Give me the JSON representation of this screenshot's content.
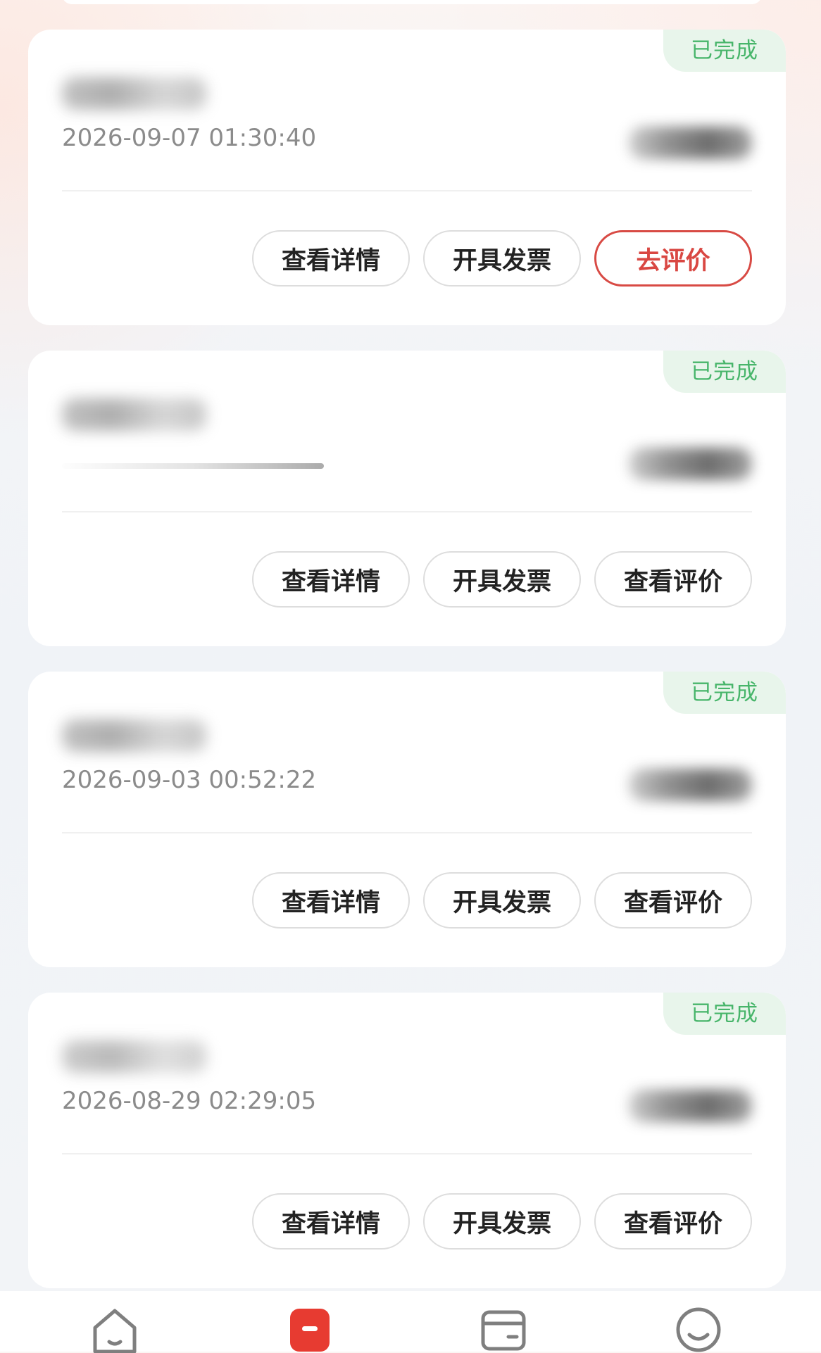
{
  "orders": [
    {
      "status": "已完成",
      "time": "2026-09-07 01:30:40",
      "actions": {
        "details": "查看详情",
        "invoice": "开具发票",
        "review": "去评价"
      }
    },
    {
      "status": "已完成",
      "time": "",
      "actions": {
        "details": "查看详情",
        "invoice": "开具发票",
        "review": "查看评价"
      }
    },
    {
      "status": "已完成",
      "time": "2026-09-03 00:52:22",
      "actions": {
        "details": "查看详情",
        "invoice": "开具发票",
        "review": "查看评价"
      }
    },
    {
      "status": "已完成",
      "time": "2026-08-29 02:29:05",
      "actions": {
        "details": "查看详情",
        "invoice": "开具发票",
        "review": "查看评价"
      }
    }
  ],
  "tab_bar": {
    "items": [
      {
        "icon": "home-icon"
      },
      {
        "icon": "orders-icon",
        "active": true
      },
      {
        "icon": "wallet-card-icon"
      },
      {
        "icon": "smile-profile-icon"
      }
    ]
  },
  "colors": {
    "status_green": "#47b56a",
    "status_bg": "#e8f5eb",
    "primary_red": "#d94742",
    "button_border": "#dddddd",
    "text_gray": "#8b8b8b",
    "icon_gray": "#7f7f7f"
  }
}
